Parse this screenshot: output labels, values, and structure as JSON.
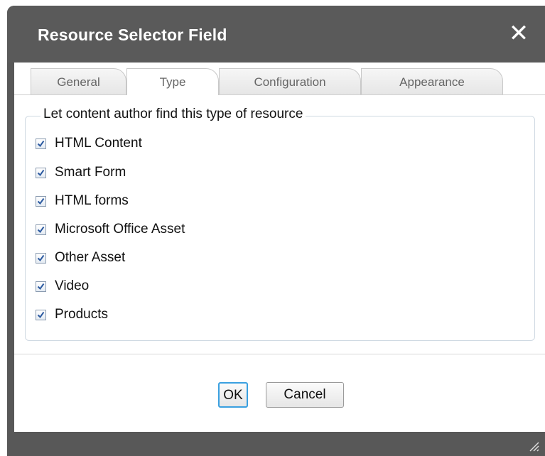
{
  "dialog": {
    "title": "Resource Selector Field",
    "close_label": "✕"
  },
  "tabs": [
    {
      "label": "General"
    },
    {
      "label": "Type"
    },
    {
      "label": "Configuration"
    },
    {
      "label": "Appearance"
    }
  ],
  "fieldset": {
    "legend": "Let content author find this type of resource",
    "options": [
      {
        "label": "HTML Content",
        "checked": true
      },
      {
        "label": "Smart Form",
        "checked": true
      },
      {
        "label": "HTML forms",
        "checked": true
      },
      {
        "label": "Microsoft Office Asset",
        "checked": true
      },
      {
        "label": "Other Asset",
        "checked": true
      },
      {
        "label": "Video",
        "checked": true
      },
      {
        "label": "Products",
        "checked": true
      }
    ]
  },
  "buttons": {
    "ok": "OK",
    "cancel": "Cancel"
  },
  "colors": {
    "titlebar": "#5a5a5a",
    "accent": "#3aa0e0",
    "check": "#2c5aa0"
  }
}
